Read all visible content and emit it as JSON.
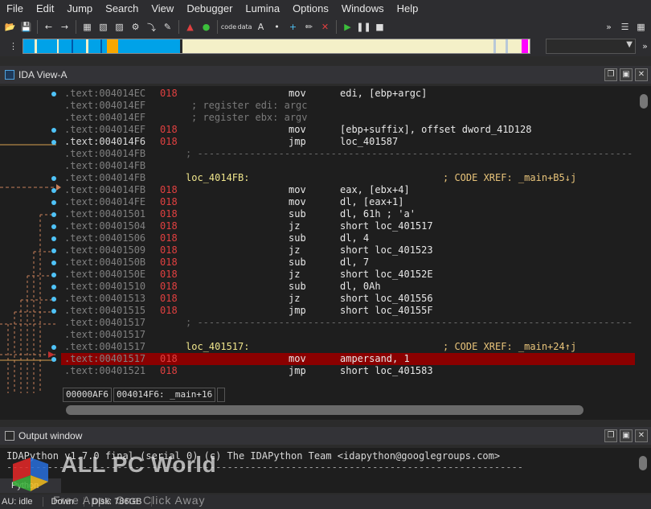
{
  "menu": [
    "File",
    "Edit",
    "Jump",
    "Search",
    "View",
    "Debugger",
    "Lumina",
    "Options",
    "Windows",
    "Help"
  ],
  "ida_view": {
    "title": "IDA View-A",
    "lines": [
      {
        "addr": ".text:004014EC",
        "sp": "018",
        "mnem": "mov",
        "ops": "edi, [ebp+argc]"
      },
      {
        "addr": ".text:004014EF",
        "comment": "; register edi: argc"
      },
      {
        "addr": ".text:004014EF",
        "comment": "; register ebx: argv"
      },
      {
        "addr": ".text:004014EF",
        "sp": "018",
        "mnem": "mov",
        "ops": "[ebp+suffix], offset dword_41D128"
      },
      {
        "addr": ".text:004014F6",
        "sp": "018",
        "mnem": "jmp",
        "ops": "loc_401587",
        "current": true
      },
      {
        "addr": ".text:004014FB",
        "separator": "; ---------------------------------------------------------------------------"
      },
      {
        "addr": ".text:004014FB"
      },
      {
        "addr": ".text:004014FB",
        "label": "loc_4014FB:",
        "xref": "; CODE XREF: _main+B5↓j"
      },
      {
        "addr": ".text:004014FB",
        "sp": "018",
        "mnem": "mov",
        "ops": "eax, [ebx+4]"
      },
      {
        "addr": ".text:004014FE",
        "sp": "018",
        "mnem": "mov",
        "ops": "dl, [eax+1]"
      },
      {
        "addr": ".text:00401501",
        "sp": "018",
        "mnem": "sub",
        "ops": "dl, 61h ; 'a'"
      },
      {
        "addr": ".text:00401504",
        "sp": "018",
        "mnem": "jz",
        "ops": "short loc_401517"
      },
      {
        "addr": ".text:00401506",
        "sp": "018",
        "mnem": "sub",
        "ops": "dl, 4"
      },
      {
        "addr": ".text:00401509",
        "sp": "018",
        "mnem": "jz",
        "ops": "short loc_401523"
      },
      {
        "addr": ".text:0040150B",
        "sp": "018",
        "mnem": "sub",
        "ops": "dl, 7"
      },
      {
        "addr": ".text:0040150E",
        "sp": "018",
        "mnem": "jz",
        "ops": "short loc_40152E"
      },
      {
        "addr": ".text:00401510",
        "sp": "018",
        "mnem": "sub",
        "ops": "dl, 0Ah"
      },
      {
        "addr": ".text:00401513",
        "sp": "018",
        "mnem": "jz",
        "ops": "short loc_401556"
      },
      {
        "addr": ".text:00401515",
        "sp": "018",
        "mnem": "jmp",
        "ops": "short loc_40155F"
      },
      {
        "addr": ".text:00401517",
        "separator": "; ---------------------------------------------------------------------------"
      },
      {
        "addr": ".text:00401517"
      },
      {
        "addr": ".text:00401517",
        "label": "loc_401517:",
        "xref": "; CODE XREF: _main+24↑j"
      },
      {
        "addr": ".text:00401517",
        "sp": "018",
        "mnem": "mov",
        "ops": "ampersand, 1",
        "highlight": true
      },
      {
        "addr": ".text:00401521",
        "sp": "018",
        "mnem": "jmp",
        "ops": "short loc_401583"
      }
    ],
    "status": [
      "00000AF6",
      "004014F6: _main+16"
    ]
  },
  "output_window": {
    "title": "Output window",
    "lines": [
      "IDAPython v1.7.0 final (serial 0) (c) The IDAPython Team <idapython@googlegroups.com>",
      "-----------------------------------------------------------------------------------------"
    ],
    "input_label": "Python"
  },
  "statusbar": {
    "au": "AU:",
    "state": "idle",
    "dir": "Down",
    "disk": "Disk: 786GB"
  },
  "watermark": {
    "title": "ALL PC World",
    "subtitle": "Free Apps One Click Away"
  },
  "colors": {
    "highlight": "#8b0000",
    "spd": "#e04040",
    "label": "#f0e68c",
    "nav_code": "#00a2e8",
    "nav_lib": "#f7a700",
    "nav_data": "#f4f0c8"
  }
}
